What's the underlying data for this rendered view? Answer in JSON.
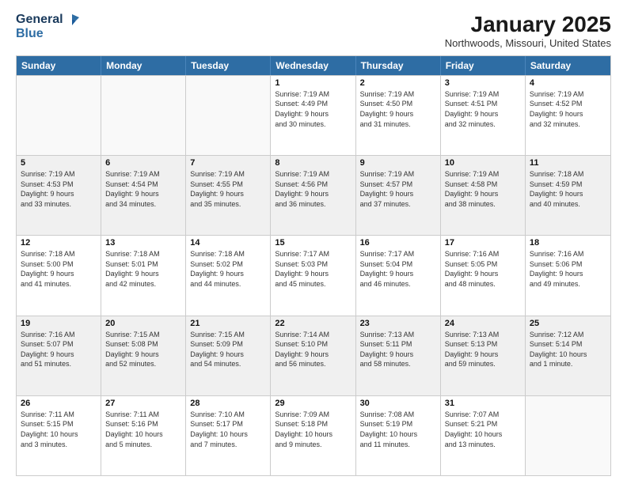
{
  "header": {
    "logo_line1": "General",
    "logo_line2": "Blue",
    "title": "January 2025",
    "subtitle": "Northwoods, Missouri, United States"
  },
  "weekdays": [
    "Sunday",
    "Monday",
    "Tuesday",
    "Wednesday",
    "Thursday",
    "Friday",
    "Saturday"
  ],
  "rows": [
    [
      {
        "day": "",
        "info": ""
      },
      {
        "day": "",
        "info": ""
      },
      {
        "day": "",
        "info": ""
      },
      {
        "day": "1",
        "info": "Sunrise: 7:19 AM\nSunset: 4:49 PM\nDaylight: 9 hours\nand 30 minutes."
      },
      {
        "day": "2",
        "info": "Sunrise: 7:19 AM\nSunset: 4:50 PM\nDaylight: 9 hours\nand 31 minutes."
      },
      {
        "day": "3",
        "info": "Sunrise: 7:19 AM\nSunset: 4:51 PM\nDaylight: 9 hours\nand 32 minutes."
      },
      {
        "day": "4",
        "info": "Sunrise: 7:19 AM\nSunset: 4:52 PM\nDaylight: 9 hours\nand 32 minutes."
      }
    ],
    [
      {
        "day": "5",
        "info": "Sunrise: 7:19 AM\nSunset: 4:53 PM\nDaylight: 9 hours\nand 33 minutes."
      },
      {
        "day": "6",
        "info": "Sunrise: 7:19 AM\nSunset: 4:54 PM\nDaylight: 9 hours\nand 34 minutes."
      },
      {
        "day": "7",
        "info": "Sunrise: 7:19 AM\nSunset: 4:55 PM\nDaylight: 9 hours\nand 35 minutes."
      },
      {
        "day": "8",
        "info": "Sunrise: 7:19 AM\nSunset: 4:56 PM\nDaylight: 9 hours\nand 36 minutes."
      },
      {
        "day": "9",
        "info": "Sunrise: 7:19 AM\nSunset: 4:57 PM\nDaylight: 9 hours\nand 37 minutes."
      },
      {
        "day": "10",
        "info": "Sunrise: 7:19 AM\nSunset: 4:58 PM\nDaylight: 9 hours\nand 38 minutes."
      },
      {
        "day": "11",
        "info": "Sunrise: 7:18 AM\nSunset: 4:59 PM\nDaylight: 9 hours\nand 40 minutes."
      }
    ],
    [
      {
        "day": "12",
        "info": "Sunrise: 7:18 AM\nSunset: 5:00 PM\nDaylight: 9 hours\nand 41 minutes."
      },
      {
        "day": "13",
        "info": "Sunrise: 7:18 AM\nSunset: 5:01 PM\nDaylight: 9 hours\nand 42 minutes."
      },
      {
        "day": "14",
        "info": "Sunrise: 7:18 AM\nSunset: 5:02 PM\nDaylight: 9 hours\nand 44 minutes."
      },
      {
        "day": "15",
        "info": "Sunrise: 7:17 AM\nSunset: 5:03 PM\nDaylight: 9 hours\nand 45 minutes."
      },
      {
        "day": "16",
        "info": "Sunrise: 7:17 AM\nSunset: 5:04 PM\nDaylight: 9 hours\nand 46 minutes."
      },
      {
        "day": "17",
        "info": "Sunrise: 7:16 AM\nSunset: 5:05 PM\nDaylight: 9 hours\nand 48 minutes."
      },
      {
        "day": "18",
        "info": "Sunrise: 7:16 AM\nSunset: 5:06 PM\nDaylight: 9 hours\nand 49 minutes."
      }
    ],
    [
      {
        "day": "19",
        "info": "Sunrise: 7:16 AM\nSunset: 5:07 PM\nDaylight: 9 hours\nand 51 minutes."
      },
      {
        "day": "20",
        "info": "Sunrise: 7:15 AM\nSunset: 5:08 PM\nDaylight: 9 hours\nand 52 minutes."
      },
      {
        "day": "21",
        "info": "Sunrise: 7:15 AM\nSunset: 5:09 PM\nDaylight: 9 hours\nand 54 minutes."
      },
      {
        "day": "22",
        "info": "Sunrise: 7:14 AM\nSunset: 5:10 PM\nDaylight: 9 hours\nand 56 minutes."
      },
      {
        "day": "23",
        "info": "Sunrise: 7:13 AM\nSunset: 5:11 PM\nDaylight: 9 hours\nand 58 minutes."
      },
      {
        "day": "24",
        "info": "Sunrise: 7:13 AM\nSunset: 5:13 PM\nDaylight: 9 hours\nand 59 minutes."
      },
      {
        "day": "25",
        "info": "Sunrise: 7:12 AM\nSunset: 5:14 PM\nDaylight: 10 hours\nand 1 minute."
      }
    ],
    [
      {
        "day": "26",
        "info": "Sunrise: 7:11 AM\nSunset: 5:15 PM\nDaylight: 10 hours\nand 3 minutes."
      },
      {
        "day": "27",
        "info": "Sunrise: 7:11 AM\nSunset: 5:16 PM\nDaylight: 10 hours\nand 5 minutes."
      },
      {
        "day": "28",
        "info": "Sunrise: 7:10 AM\nSunset: 5:17 PM\nDaylight: 10 hours\nand 7 minutes."
      },
      {
        "day": "29",
        "info": "Sunrise: 7:09 AM\nSunset: 5:18 PM\nDaylight: 10 hours\nand 9 minutes."
      },
      {
        "day": "30",
        "info": "Sunrise: 7:08 AM\nSunset: 5:19 PM\nDaylight: 10 hours\nand 11 minutes."
      },
      {
        "day": "31",
        "info": "Sunrise: 7:07 AM\nSunset: 5:21 PM\nDaylight: 10 hours\nand 13 minutes."
      },
      {
        "day": "",
        "info": ""
      }
    ]
  ]
}
